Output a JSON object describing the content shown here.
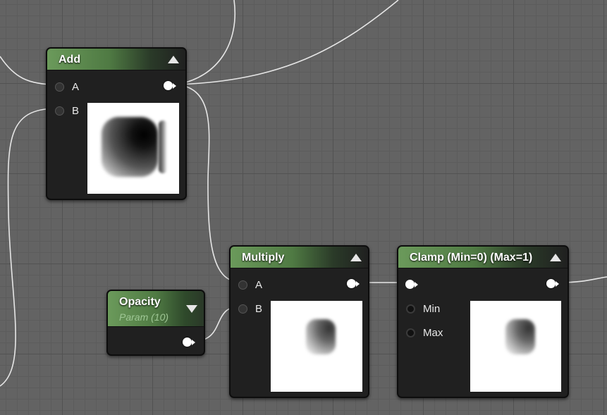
{
  "nodes": {
    "add": {
      "title": "Add",
      "inputs": [
        {
          "label": "A"
        },
        {
          "label": "B"
        }
      ]
    },
    "multiply": {
      "title": "Multiply",
      "inputs": [
        {
          "label": "A"
        },
        {
          "label": "B"
        }
      ]
    },
    "clamp": {
      "title": "Clamp (Min=0) (Max=1)",
      "inputs": [
        {
          "label": "Min"
        },
        {
          "label": "Max"
        }
      ]
    },
    "opacity": {
      "title": "Opacity",
      "subtitle": "Param (10)"
    }
  },
  "colors": {
    "canvas": "#636363",
    "node_body": "#202020",
    "header_green": "#6b9a5b",
    "wire": "#e8e8e8",
    "param_subtitle": "#9fc795"
  }
}
